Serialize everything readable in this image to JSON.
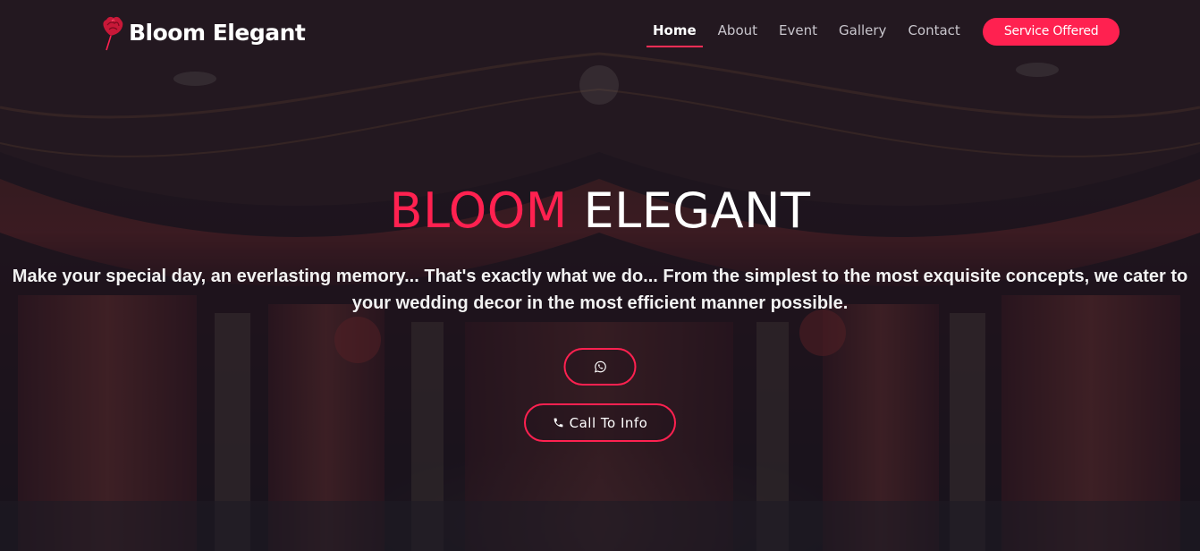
{
  "brand": {
    "name": "Bloom Elegant",
    "logo_icon": "rose-icon"
  },
  "nav": {
    "items": [
      {
        "label": "Home",
        "active": true
      },
      {
        "label": "About",
        "active": false
      },
      {
        "label": "Event",
        "active": false
      },
      {
        "label": "Gallery",
        "active": false
      },
      {
        "label": "Contact",
        "active": false
      }
    ],
    "cta_label": "Service Offered"
  },
  "hero": {
    "title_accent": "BLOOM",
    "title_rest": "ELEGANT",
    "subtitle": "Make your special day, an everlasting memory... That's exactly what we do... From the simplest to the most exquisite concepts, we cater to your wedding decor in the most efficient manner possible.",
    "whatsapp_icon": "whatsapp-icon",
    "call_label": "Call To Info",
    "call_icon": "phone-icon"
  },
  "colors": {
    "accent": "#ff2150",
    "text": "#ffffff",
    "overlay": "#141220"
  }
}
